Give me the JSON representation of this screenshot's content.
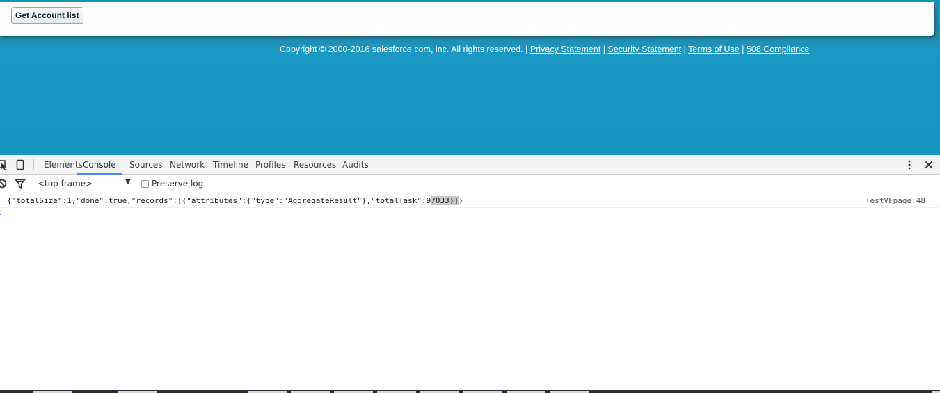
{
  "page": {
    "get_account_button": "Get Account list",
    "footer": {
      "copyright": "Copyright © 2000-2016 salesforce.com, inc. All rights reserved. |",
      "links": [
        "Privacy Statement",
        "Security Statement",
        "Terms of Use",
        "508 Compliance"
      ],
      "separator": "|"
    },
    "colors": {
      "brand_blue": "#1895c1"
    }
  },
  "devtools": {
    "tabs": [
      {
        "label": "Elements",
        "active": false
      },
      {
        "label": "Console",
        "active": true
      },
      {
        "label": "Sources",
        "active": false
      },
      {
        "label": "Network",
        "active": false
      },
      {
        "label": "Timeline",
        "active": false
      },
      {
        "label": "Profiles",
        "active": false
      },
      {
        "label": "Resources",
        "active": false
      },
      {
        "label": "Audits",
        "active": false
      }
    ],
    "icons": {
      "inspect": "inspect-element-icon",
      "device": "device-mode-icon",
      "more": "more-vertical-icon",
      "close": "close-icon",
      "clear": "clear-console-icon",
      "filter": "filter-icon"
    },
    "toolbar": {
      "frame_select": "<top frame>",
      "frame_arrow": "▼",
      "preserve_log_label": "Preserve log",
      "preserve_log_checked": false
    },
    "console": {
      "messages": [
        {
          "text_before": "{\"totalSize\":1,\"done\":true,\"records\":[{\"attributes\":{\"type\":\"AggregateResult\"},\"totalTask\":9",
          "text_highlight": "7033}]",
          "text_after": "}",
          "source": "TestVFpage:48"
        }
      ]
    }
  }
}
